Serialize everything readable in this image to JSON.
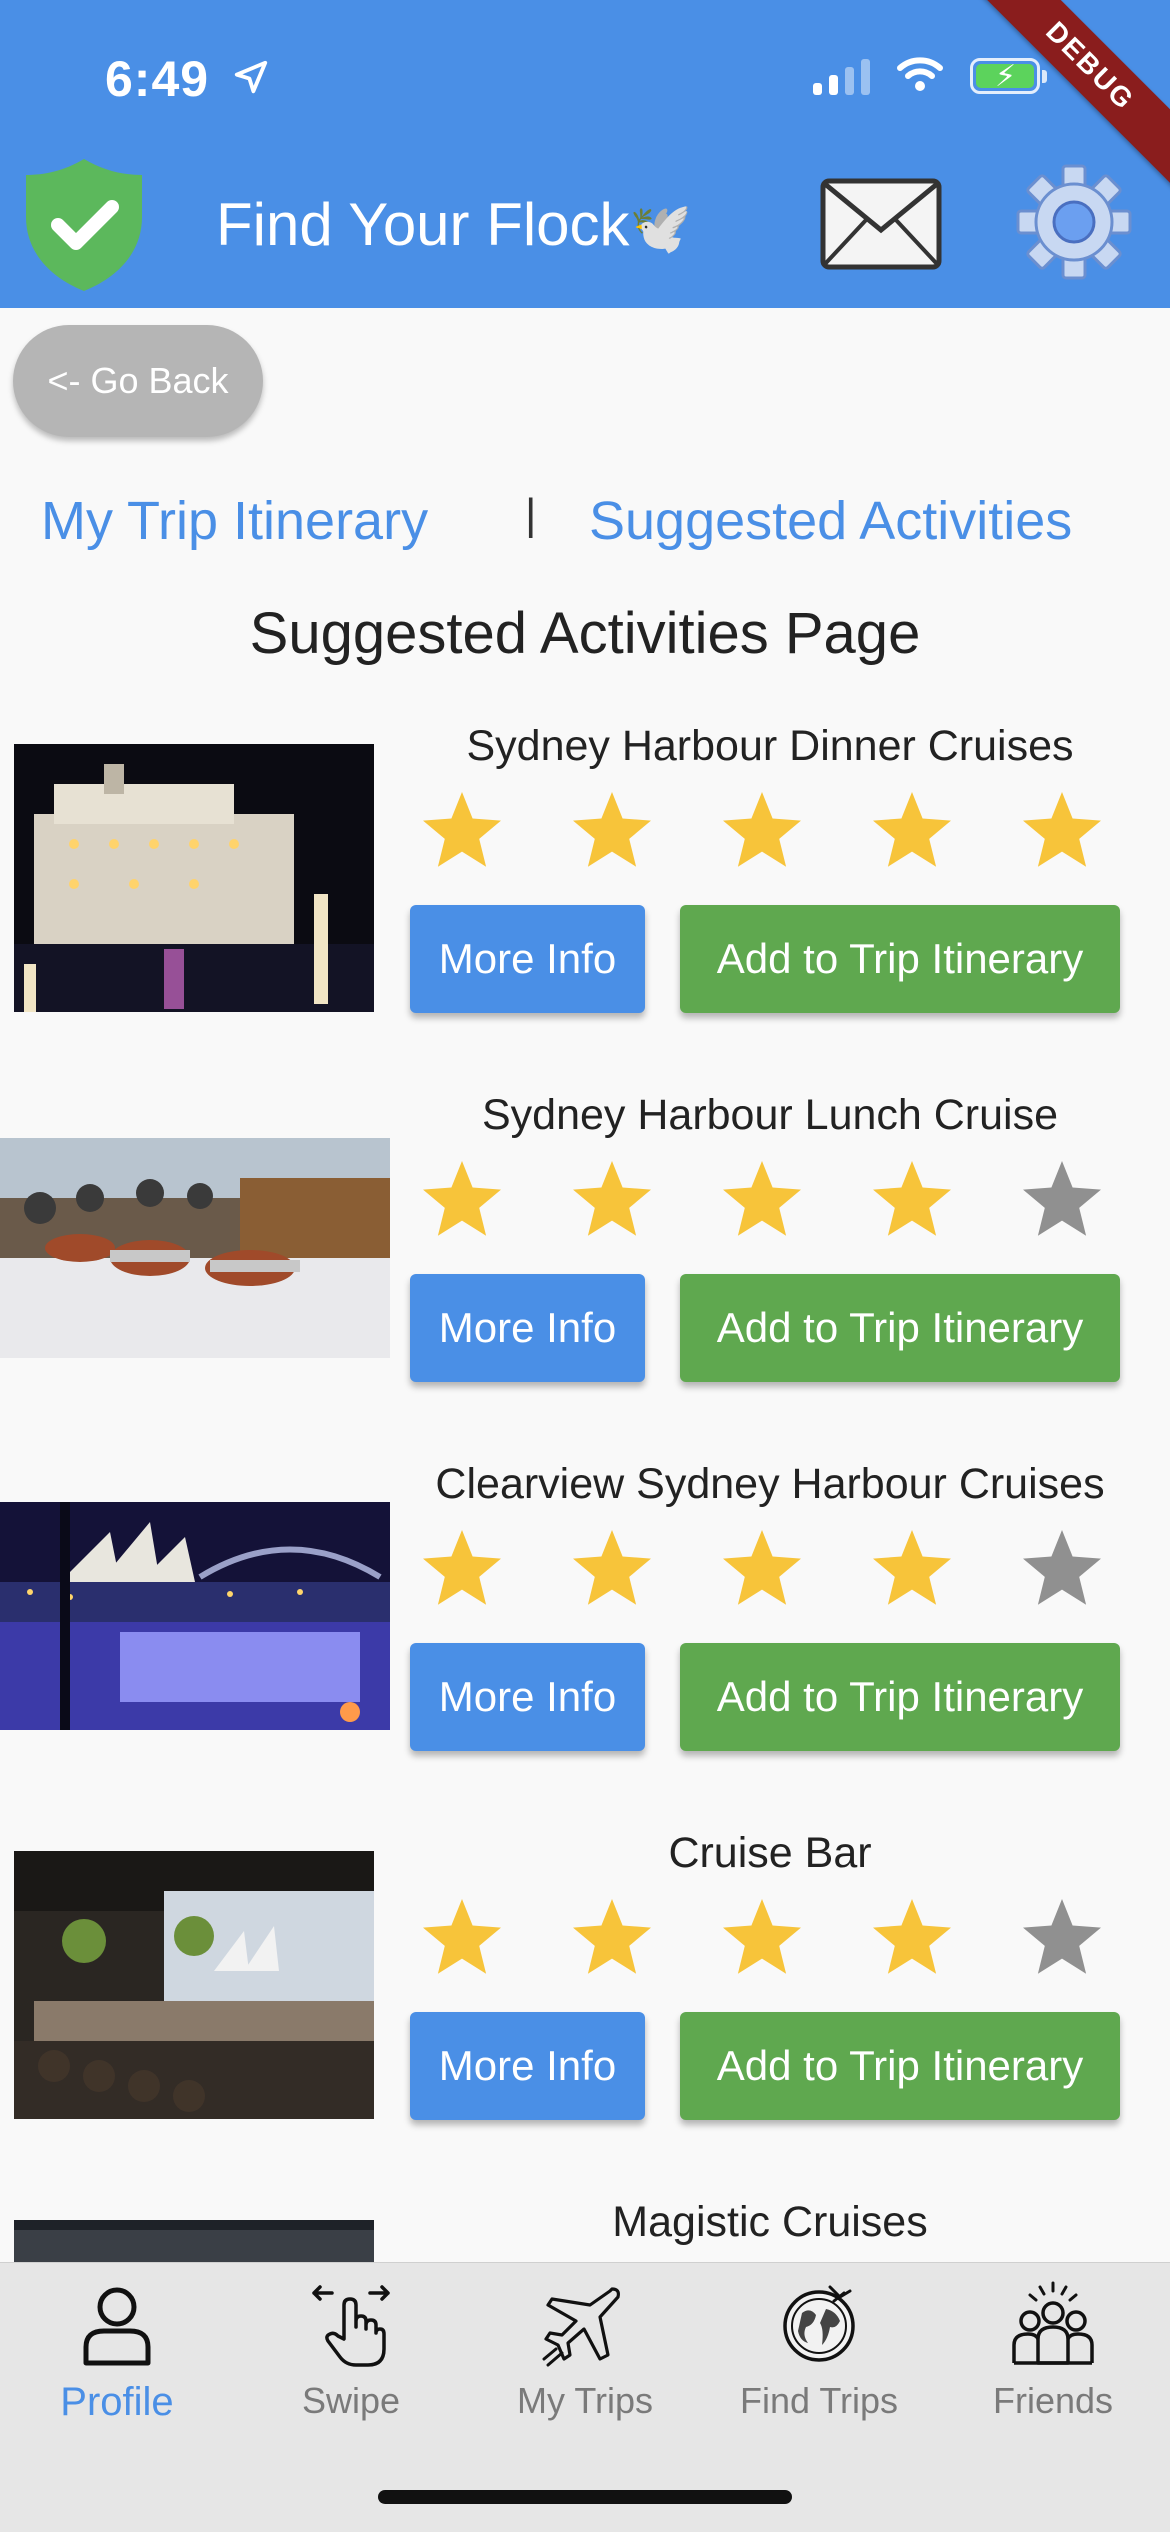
{
  "status_bar": {
    "time": "6:49"
  },
  "debug_banner": "DEBUG",
  "header": {
    "title": "Find Your Flock",
    "title_emoji": "🕊️"
  },
  "go_back_label": "<- Go Back",
  "tabs": [
    {
      "label": "My Trip Itinerary"
    },
    {
      "label": "Suggested Activities"
    }
  ],
  "tab_separator": "|",
  "page_title": "Suggested Activities Page",
  "activities": [
    {
      "name": "Sydney Harbour Dinner Cruises",
      "rating": 5,
      "more_info_label": "More Info",
      "add_label": "Add to Trip Itinerary"
    },
    {
      "name": "Sydney Harbour Lunch Cruise",
      "rating": 4,
      "more_info_label": "More Info",
      "add_label": "Add to Trip Itinerary"
    },
    {
      "name": "Clearview Sydney Harbour Cruises",
      "rating": 4,
      "more_info_label": "More Info",
      "add_label": "Add to Trip Itinerary"
    },
    {
      "name": "Cruise Bar",
      "rating": 4,
      "more_info_label": "More Info",
      "add_label": "Add to Trip Itinerary"
    },
    {
      "name": "Magistic Cruises"
    }
  ],
  "bottom_nav": [
    {
      "label": "Profile",
      "icon": "person-icon",
      "active": true
    },
    {
      "label": "Swipe",
      "icon": "swipe-hand-icon"
    },
    {
      "label": "My Trips",
      "icon": "airplane-icon"
    },
    {
      "label": "Find Trips",
      "icon": "globe-icon"
    },
    {
      "label": "Friends",
      "icon": "group-icon"
    }
  ],
  "colors": {
    "primary": "#4a8fe6",
    "success": "#5fa84f",
    "star_filled": "#f7c43a",
    "star_empty": "#909090",
    "shield": "#5cb85c"
  }
}
